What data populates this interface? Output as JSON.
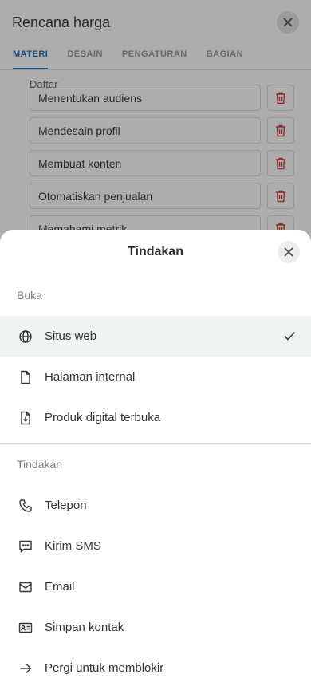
{
  "background": {
    "title": "Rencana harga",
    "tabs": [
      {
        "label": "MATERI"
      },
      {
        "label": "DESAIN"
      },
      {
        "label": "PENGATURAN"
      },
      {
        "label": "BAGIAN"
      }
    ],
    "partial_label": "Daftar",
    "rows": [
      {
        "label": "Menentukan audiens"
      },
      {
        "label": "Mendesain profil"
      },
      {
        "label": "Membuat konten"
      },
      {
        "label": "Otomatiskan penjualan"
      },
      {
        "label": "Memahami metrik"
      }
    ]
  },
  "sheet": {
    "title": "Tindakan",
    "open_section": {
      "label": "Buka",
      "items": [
        {
          "label": "Situs web",
          "icon": "globe-icon"
        },
        {
          "label": "Halaman internal",
          "icon": "page-icon"
        },
        {
          "label": "Produk digital terbuka",
          "icon": "download-file-icon"
        }
      ]
    },
    "action_section": {
      "label": "Tindakan",
      "items": [
        {
          "label": "Telepon",
          "icon": "phone-icon"
        },
        {
          "label": "Kirim SMS",
          "icon": "sms-icon"
        },
        {
          "label": "Email",
          "icon": "mail-icon"
        },
        {
          "label": "Simpan kontak",
          "icon": "contact-card-icon"
        },
        {
          "label": "Pergi untuk memblokir",
          "icon": "arrow-right-icon"
        }
      ]
    }
  }
}
